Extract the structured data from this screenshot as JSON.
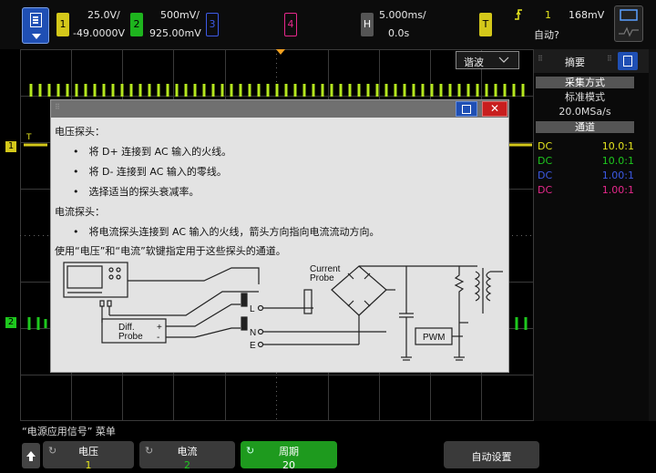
{
  "ch1": {
    "num": "1",
    "scale": "25.0V/",
    "offset": "-49.0000V",
    "color": "#e6e61e"
  },
  "ch2": {
    "num": "2",
    "scale": "500mV/",
    "offset": "925.00mV",
    "color": "#1ec81e"
  },
  "ch3": {
    "num": "3",
    "color": "#3c5ae6"
  },
  "ch4": {
    "num": "4",
    "color": "#e6288c"
  },
  "timebase": {
    "key": "H",
    "scale": "5.000ms/",
    "delay": "0.0s"
  },
  "trigger": {
    "key": "T",
    "slope_icon": "rising-edge-icon",
    "source": "1",
    "level": "168mV",
    "mode": "自动?"
  },
  "filter_tab": {
    "label": "谐波",
    "icon": "chevron-down-icon"
  },
  "sidebar": {
    "title": "摘要",
    "acq_header": "采集方式",
    "acq_mode": "标准模式",
    "sample_rate": "20.0MSa/s",
    "channels_header": "通道",
    "channels": [
      {
        "coupling": "DC",
        "ratio": "10.0:1",
        "color": "#e6e61e"
      },
      {
        "coupling": "DC",
        "ratio": "10.0:1",
        "color": "#1ec81e"
      },
      {
        "coupling": "DC",
        "ratio": "1.00:1",
        "color": "#3c5ae6"
      },
      {
        "coupling": "DC",
        "ratio": "1.00:1",
        "color": "#e6288c"
      }
    ]
  },
  "markers": {
    "ch1": "1",
    "ch2": "2",
    "trig_t": "T"
  },
  "dialog": {
    "lines": [
      "电压探头：",
      "•　将 D+ 连接到 AC 输入的火线。",
      "•　将 D- 连接到 AC 输入的零线。",
      "•　选择适当的探头衰减率。",
      "电流探头：",
      "•　将电流探头连接到 AC 输入的火线，箭头方向指向电流流动方向。",
      "使用“电压”和“电流”软键指定用于这些探头的通道。"
    ],
    "diagram": {
      "current_probe": [
        "Current",
        "Probe"
      ],
      "diff_probe": [
        "Diff.",
        "Probe"
      ],
      "plus": "+",
      "minus": "-",
      "L": "L",
      "N": "N",
      "E": "E",
      "pwm": "PWM"
    }
  },
  "menu_title": "“电源应用信号” 菜单",
  "softkeys": [
    {
      "label": "电压",
      "value": "1",
      "value_color": "#e6e61e"
    },
    {
      "label": "电流",
      "value": "2",
      "value_color": "#1ec81e"
    },
    {
      "label": "周期",
      "value": "20",
      "value_color": "#ffffff"
    },
    {
      "label": "自动设置",
      "value": "",
      "value_color": "#ffffff"
    }
  ]
}
